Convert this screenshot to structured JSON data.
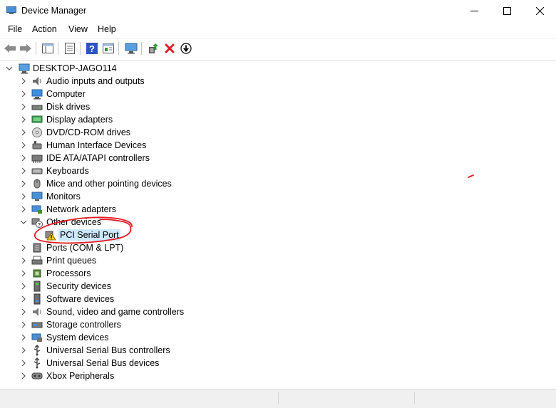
{
  "window": {
    "title": "Device Manager"
  },
  "menu": [
    "File",
    "Action",
    "View",
    "Help"
  ],
  "tree": {
    "root": "DESKTOP-JAGO114",
    "categories": [
      "Audio inputs and outputs",
      "Computer",
      "Disk drives",
      "Display adapters",
      "DVD/CD-ROM drives",
      "Human Interface Devices",
      "IDE ATA/ATAPI controllers",
      "Keyboards",
      "Mice and other pointing devices",
      "Monitors",
      "Network adapters",
      "Other devices",
      "Ports (COM & LPT)",
      "Print queues",
      "Processors",
      "Security devices",
      "Software devices",
      "Sound, video and game controllers",
      "Storage controllers",
      "System devices",
      "Universal Serial Bus controllers",
      "Universal Serial Bus devices",
      "Xbox Peripherals"
    ],
    "expanded_children": [
      "PCI Serial Port"
    ]
  },
  "colors": {
    "selection": "#cce8ff",
    "annotation": "#e31b23",
    "warning": "#f5c518"
  }
}
